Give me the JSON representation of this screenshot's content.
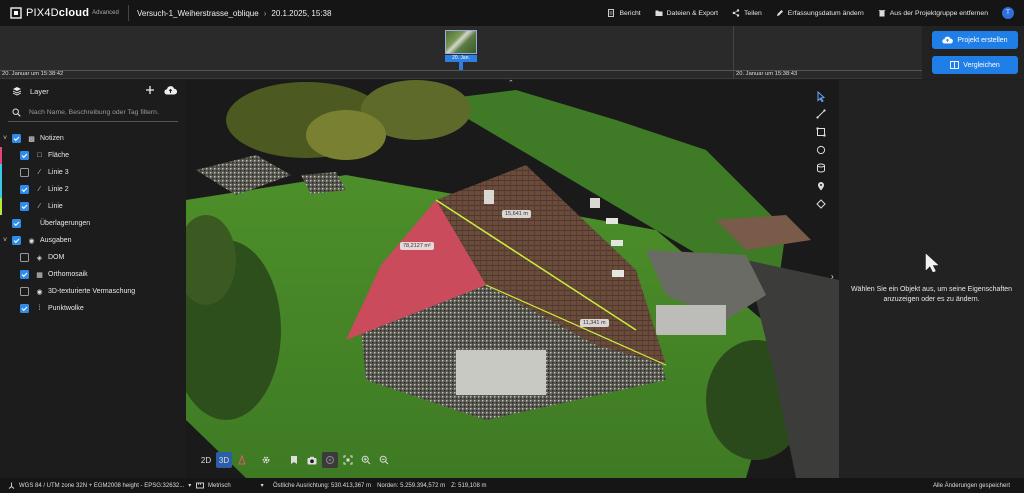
{
  "app": {
    "name_regular": "PIX4D",
    "name_bold": "cloud",
    "edition": "Advanced"
  },
  "breadcrumb": {
    "project": "Versuch-1_Weiherstrasse_oblique",
    "date": "20.1.2025, 15:38"
  },
  "top_actions": [
    {
      "label": "Bericht",
      "icon": "report-icon"
    },
    {
      "label": "Dateien & Export",
      "icon": "folder-icon"
    },
    {
      "label": "Teilen",
      "icon": "share-icon"
    },
    {
      "label": "Erfassungsdatum ändern",
      "icon": "pencil-icon"
    },
    {
      "label": "Aus der Projektgruppe entfernen",
      "icon": "trash-icon"
    }
  ],
  "user": {
    "initial": "T"
  },
  "timeline": {
    "thumb_tag": "20. Jan.",
    "left_time": "20. Januar um 15:38:42",
    "right_time": "20. Januar um 15:38:43"
  },
  "actions": {
    "create_project": "Projekt erstellen",
    "compare": "Vergleichen"
  },
  "layers": {
    "title": "Layer",
    "search_placeholder": "Nach Name, Beschreibung oder Tag filtern.",
    "items": [
      {
        "label": "Notizen",
        "checked": true,
        "caret": "˅",
        "level": 0
      },
      {
        "label": "Fläche",
        "checked": true,
        "level": 1,
        "stripe": "#e0457b"
      },
      {
        "label": "Linie 3",
        "checked": false,
        "level": 1,
        "stripe": "#3ec7e8"
      },
      {
        "label": "Linie 2",
        "checked": true,
        "level": 1,
        "stripe": "#3ec7e8"
      },
      {
        "label": "Linie",
        "checked": true,
        "level": 1,
        "stripe": "#b7e83e"
      },
      {
        "label": "Überlagerungen",
        "checked": true,
        "level": 0
      },
      {
        "label": "Ausgaben",
        "checked": true,
        "caret": "˅",
        "level": 0
      },
      {
        "label": "DOM",
        "checked": false,
        "level": 1
      },
      {
        "label": "Orthomosaik",
        "checked": true,
        "level": 1
      },
      {
        "label": "3D-texturierte Vermaschung",
        "checked": false,
        "level": 1
      },
      {
        "label": "Punktwolke",
        "checked": true,
        "level": 1
      }
    ]
  },
  "viewport": {
    "measurements": {
      "area": "78,2127 m²",
      "line_top": "15,641 m",
      "line_bottom": "11,341 m"
    },
    "modes": {
      "two_d": "2D",
      "three_d": "3D"
    }
  },
  "right_panel": {
    "hint": "Wählen Sie ein Objekt aus, um seine Eigenschaften anzuzeigen oder es zu ändern."
  },
  "status": {
    "crs": "WGS 84 / UTM zone 32N + EGM2008 height - EPSG:32632...",
    "units": "Metrisch",
    "easting": "Östliche Ausrichtung: 530.413,367 m",
    "northing": "Norden: 5.259.394,572 m",
    "z": "Z: 519,108 m",
    "saved": "Alle Änderungen gespeichert"
  }
}
